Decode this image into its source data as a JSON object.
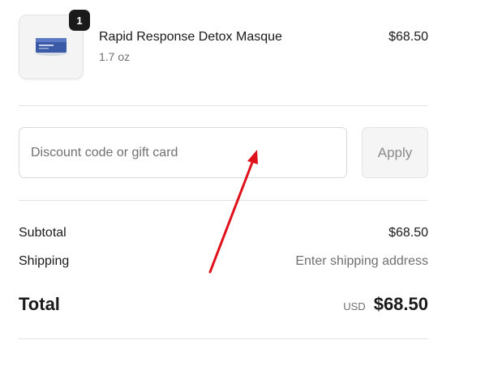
{
  "cart": {
    "item": {
      "name": "Rapid Response Detox Masque",
      "variant": "1.7 oz",
      "price": "$68.50",
      "quantity": "1"
    }
  },
  "discount": {
    "placeholder": "Discount code or gift card",
    "apply_label": "Apply"
  },
  "summary": {
    "subtotal_label": "Subtotal",
    "subtotal_value": "$68.50",
    "shipping_label": "Shipping",
    "shipping_value": "Enter shipping address",
    "total_label": "Total",
    "currency": "USD",
    "total_value": "$68.50"
  },
  "colors": {
    "annotation_arrow": "#e0101a",
    "badge": "#1a1a1a",
    "product_jar": "#3a5aa8"
  }
}
